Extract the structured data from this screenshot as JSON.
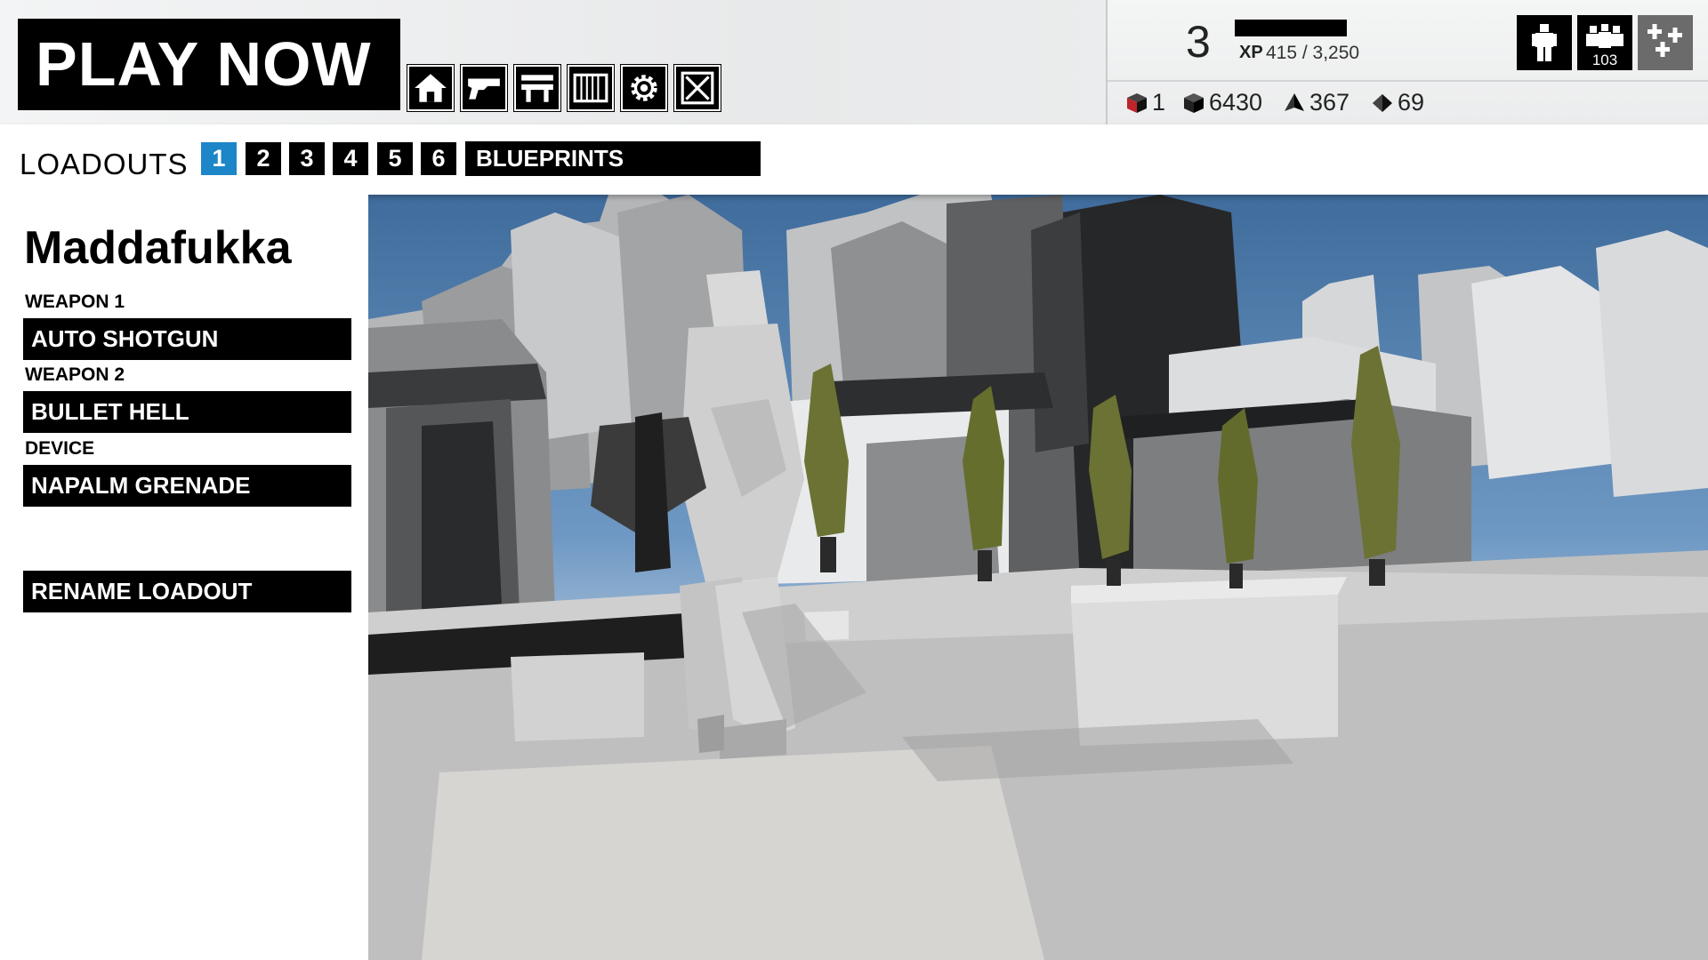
{
  "header": {
    "play_now": "PLAY NOW",
    "nav_icons": [
      "home-icon",
      "weapon-icon",
      "workbench-icon",
      "inventory-icon",
      "settings-icon",
      "exit-icon"
    ]
  },
  "player": {
    "level": "3",
    "xp_label": "XP",
    "xp_value": "415 / 3,250"
  },
  "currencies": [
    {
      "icon": "red-cube-icon",
      "value": "1",
      "color": "#c0242b"
    },
    {
      "icon": "cube-icon",
      "value": "6430"
    },
    {
      "icon": "pyramid-icon",
      "value": "367"
    },
    {
      "icon": "diamond-icon",
      "value": "69"
    }
  ],
  "squad": {
    "buttons": [
      "soldier-icon",
      "squad-icon",
      "add-squad-icon"
    ],
    "count": "103"
  },
  "loadouts": {
    "label": "LOADOUTS",
    "slots": [
      "1",
      "2",
      "3",
      "4",
      "5",
      "6"
    ],
    "active_slot": "1",
    "blueprints": "BLUEPRINTS"
  },
  "loadout": {
    "name": "Maddafukka",
    "weapon1_label": "WEAPON 1",
    "weapon1": "AUTO SHOTGUN",
    "weapon2_label": "WEAPON 2",
    "weapon2": "BULLET HELL",
    "device_label": "DEVICE",
    "device": "NAPALM GRENADE",
    "rename": "RENAME LOADOUT"
  },
  "colors": {
    "accent": "#1d86c8",
    "button_bg": "#000000",
    "button_text": "#ffffff"
  }
}
